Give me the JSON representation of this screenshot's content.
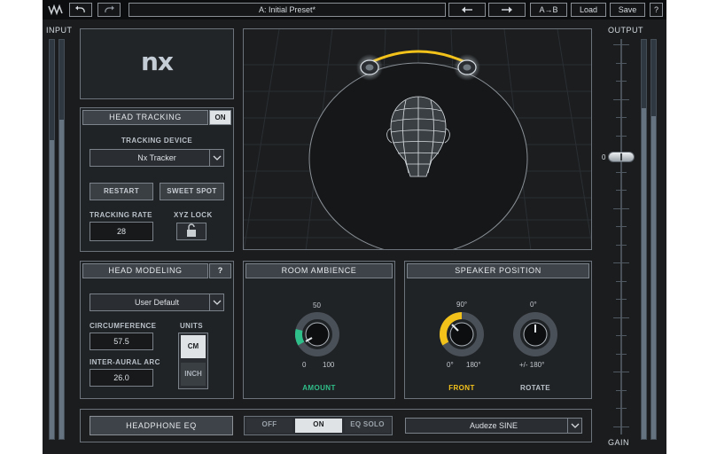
{
  "toolbar": {
    "undo_icon": "undo-icon",
    "redo_icon": "redo-icon",
    "preset_name": "A: Initial Preset*",
    "ab_label": "A→B",
    "load_label": "Load",
    "save_label": "Save",
    "help_label": "?"
  },
  "meters": {
    "input_title": "INPUT",
    "output_title": "OUTPUT",
    "gain_label": "GAIN",
    "gain_value": "0"
  },
  "logo": {
    "text": "nx"
  },
  "head_tracking": {
    "title": "HEAD TRACKING",
    "on_label": "ON",
    "device_label": "TRACKING DEVICE",
    "device_value": "Nx Tracker",
    "restart_label": "RESTART",
    "sweet_spot_label": "SWEET SPOT",
    "rate_label": "TRACKING RATE",
    "rate_value": "28",
    "xyz_lock_label": "XYZ LOCK"
  },
  "head_modeling": {
    "title": "HEAD MODELING",
    "help_label": "?",
    "preset_value": "User Default",
    "circumference_label": "CIRCUMFERENCE",
    "circumference_value": "57.5",
    "interaural_label": "INTER-AURAL ARC",
    "interaural_value": "26.0",
    "units_label": "UNITS",
    "cm_label": "CM",
    "inch_label": "INCH"
  },
  "room_ambience": {
    "title": "ROOM AMBIENCE",
    "top_value": "50",
    "min_value": "0",
    "max_value": "100",
    "knob_label": "AMOUNT"
  },
  "speaker_position": {
    "title": "SPEAKER POSITION",
    "front_top": "90°",
    "front_min": "0°",
    "front_max": "180°",
    "front_label": "FRONT",
    "rotate_top": "0°",
    "rotate_range": "+/- 180°",
    "rotate_label": "ROTATE"
  },
  "headphone_eq": {
    "title": "HEADPHONE EQ",
    "off_label": "OFF",
    "on_label": "ON",
    "solo_label": "EQ SOLO",
    "model_value": "Audeze SINE"
  },
  "colors": {
    "accent_green": "#2fbf8a",
    "accent_yellow": "#f2c21b",
    "panel_bg": "#202326",
    "border": "#6c737b"
  }
}
